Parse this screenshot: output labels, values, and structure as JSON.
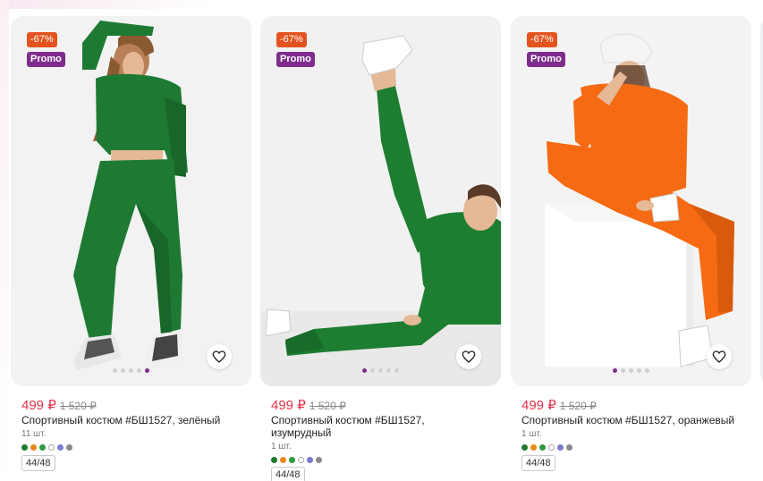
{
  "colors": {
    "discount": "#e4531f",
    "promo": "#7e2d8c",
    "price": "#e4304a",
    "swatch_palette": [
      "#1a7a2c",
      "#e98a17",
      "#2f9a3d",
      "#ffffff",
      "#7a7ad0",
      "#8a8a8a"
    ]
  },
  "products": [
    {
      "discount_badge": "-67%",
      "promo_badge": "Promo",
      "price_new": "499 ₽",
      "price_old": "1 520 ₽",
      "name": "Спортивный костюм #БШ1527, зелёный",
      "stock": "11 шт.",
      "size": "44/48",
      "favorite_icon": "heart-icon",
      "active_slide": 4,
      "slides": 5,
      "photo_color": "#1e7a33"
    },
    {
      "discount_badge": "-67%",
      "promo_badge": "Promo",
      "price_new": "499 ₽",
      "price_old": "1 520 ₽",
      "name": "Спортивный костюм #БШ1527, изумрудный",
      "stock": "1 шт.",
      "size": "44/48",
      "favorite_icon": "heart-icon",
      "active_slide": 0,
      "slides": 5,
      "photo_color": "#1d7d30"
    },
    {
      "discount_badge": "-67%",
      "promo_badge": "Promo",
      "price_new": "499 ₽",
      "price_old": "1 520 ₽",
      "name": "Спортивный костюм #БШ1527, оранжевый",
      "stock": "1 шт.",
      "size": "44/48",
      "favorite_icon": "heart-icon",
      "active_slide": 0,
      "slides": 5,
      "photo_color": "#f56a12"
    }
  ]
}
